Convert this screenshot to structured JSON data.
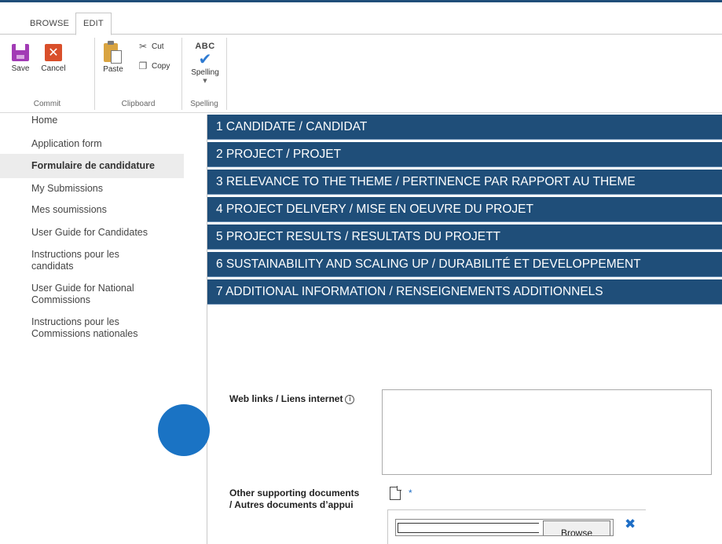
{
  "ribbon_tabs": [
    "BROWSE",
    "EDIT"
  ],
  "ribbon": {
    "commit": {
      "save_label": "Save",
      "cancel_label": "Cancel",
      "group_label": "Commit"
    },
    "clipboard": {
      "paste_label": "Paste",
      "cut_label": "Cut",
      "copy_label": "Copy",
      "group_label": "Clipboard"
    },
    "spelling": {
      "icon_text": "ABC",
      "button_label": "Spelling",
      "group_label": "Spelling"
    }
  },
  "nav": {
    "items": [
      "Home",
      "Application form",
      "Formulaire de candidature",
      "My Submissions",
      "Mes soumissions",
      "User Guide for Candidates",
      "Instructions pour les candidats",
      "User Guide for National Commissions",
      "Instructions pour les Commissions nationales"
    ],
    "active_index": 2
  },
  "sections": [
    "1 CANDIDATE / CANDIDAT",
    "2 PROJECT / PROJET",
    "3 RELEVANCE TO THE THEME / PERTINENCE PAR RAPPORT AU THEME",
    "4 PROJECT DELIVERY / MISE EN OEUVRE DU PROJET",
    "5 PROJECT RESULTS / RESULTATS DU PROJETT",
    "6 SUSTAINABILITY AND SCALING UP / DURABILITÉ ET DEVELOPPEMENT",
    "7 ADDITIONAL INFORMATION / RENSEIGNEMENTS ADDITIONNELS"
  ],
  "form": {
    "web_links_label": "Web links / Liens internet",
    "web_links_value": "",
    "other_docs_label_1": "Other supporting documents",
    "other_docs_label_2": "/ Autres documents d’appui",
    "required_mark": "*",
    "browse_label": "Browse"
  },
  "colors": {
    "section_bar": "#1f4e79",
    "accent_blue": "#1e6ec6",
    "cursor_dot": "#1a73c4"
  }
}
